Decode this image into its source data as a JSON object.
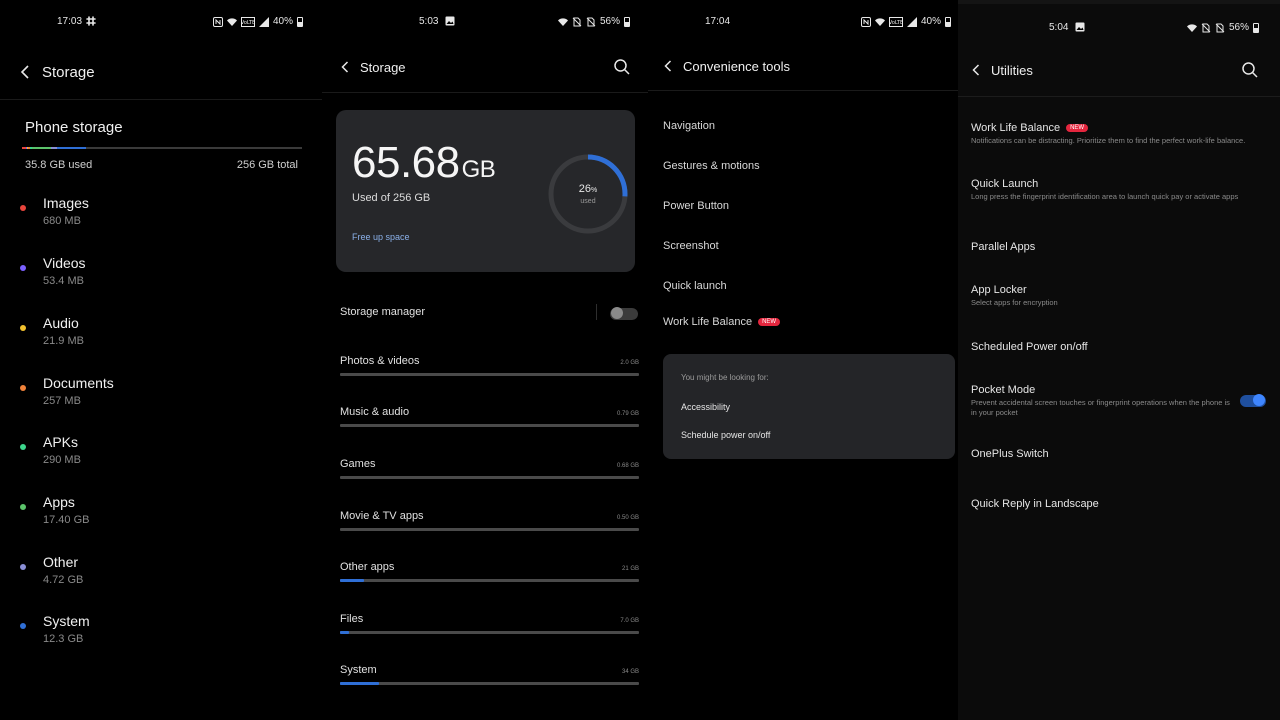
{
  "panel1": {
    "status": {
      "time": "17:03",
      "battery": "40%"
    },
    "title": "Storage",
    "section_title": "Phone storage",
    "used": "35.8 GB used",
    "total": "256 GB total",
    "bar_colors": [
      "#e8453c",
      "#7b61ff",
      "#f2c12e",
      "#f0823a",
      "#3dd68c",
      "#5cc46b",
      "#8a8fd6",
      "#2f6fd6"
    ],
    "categories": [
      {
        "name": "Images",
        "size": "680 MB",
        "color": "#e8453c"
      },
      {
        "name": "Videos",
        "size": "53.4 MB",
        "color": "#7b61ff"
      },
      {
        "name": "Audio",
        "size": "21.9 MB",
        "color": "#f2c12e"
      },
      {
        "name": "Documents",
        "size": "257 MB",
        "color": "#f0823a"
      },
      {
        "name": "APKs",
        "size": "290 MB",
        "color": "#3dd68c"
      },
      {
        "name": "Apps",
        "size": "17.40  GB",
        "color": "#5cc46b"
      },
      {
        "name": "Other",
        "size": "4.72 GB",
        "color": "#8a8fd6"
      },
      {
        "name": "System",
        "size": "12.3 GB",
        "color": "#2f6fd6"
      }
    ]
  },
  "panel2": {
    "status": {
      "time": "5:03",
      "battery": "56%"
    },
    "title": "Storage",
    "big_value": "65.68",
    "big_unit": "GB",
    "used_of": "Used of 256 GB",
    "free_up": "Free up space",
    "percent_value": "26",
    "percent_sign": "%",
    "percent_label": "used",
    "used_fraction": 0.26,
    "manager_label": "Storage manager",
    "manager_enabled": false,
    "rows": [
      {
        "label": "Photos & videos",
        "value": "2.0 GB",
        "fill": 0.0
      },
      {
        "label": "Music & audio",
        "value": "0.79 GB",
        "fill": 0.0
      },
      {
        "label": "Games",
        "value": "0.68 GB",
        "fill": 0.0
      },
      {
        "label": "Movie & TV apps",
        "value": "0.50 GB",
        "fill": 0.0
      },
      {
        "label": "Other apps",
        "value": "21 GB",
        "fill": 0.08
      },
      {
        "label": "Files",
        "value": "7.0 GB",
        "fill": 0.03
      },
      {
        "label": "System",
        "value": "34 GB",
        "fill": 0.13
      }
    ],
    "accent": "#2f6fd6"
  },
  "panel3": {
    "status": {
      "time": "17:04",
      "battery": "40%"
    },
    "title": "Convenience tools",
    "items": [
      "Navigation",
      "Gestures & motions",
      "Power Button",
      "Screenshot",
      "Quick launch"
    ],
    "work_life": "Work Life Balance",
    "new_badge": "NEW",
    "suggestions_hint": "You might be looking for:",
    "suggestions": [
      "Accessibility",
      "Schedule power on/off"
    ]
  },
  "panel4": {
    "status": {
      "time": "5:04",
      "battery": "56%"
    },
    "title": "Utilities",
    "new_badge": "NEW",
    "items": [
      {
        "title": "Work Life Balance",
        "desc": "Notifications can be distracting. Prioritize them to find the perfect work-life balance."
      },
      {
        "title": "Quick Launch",
        "desc": "Long press the fingerprint identification area to launch quick pay or activate apps"
      },
      {
        "title": "Parallel Apps",
        "desc": ""
      },
      {
        "title": "App Locker",
        "desc": "Select apps for encryption"
      },
      {
        "title": "Scheduled Power on/off",
        "desc": ""
      },
      {
        "title": "Pocket Mode",
        "desc": "Prevent accidental screen touches or fingerprint operations when the phone is in your pocket"
      },
      {
        "title": "OnePlus Switch",
        "desc": ""
      },
      {
        "title": "Quick Reply in Landscape",
        "desc": ""
      }
    ],
    "pocket_mode_enabled": true
  }
}
